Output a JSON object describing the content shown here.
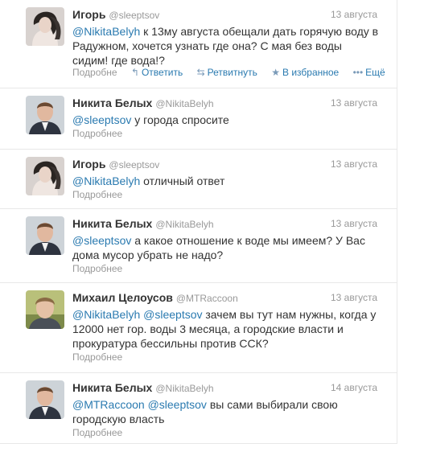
{
  "tweets": [
    {
      "name": "Игорь",
      "handle": "@sleeptsov",
      "date": "13 августа",
      "mentions": [
        "@NikitaBelyh"
      ],
      "text": " к 13му августа обещали дать горячую воду в Радужном, хочется узнать где она? С мая без воды сидим! где вода!?",
      "more": "Подробне",
      "actions": {
        "reply": "Ответить",
        "retweet": "Ретвитнуть",
        "favorite": "В избранное",
        "ellipsis": "Ещё"
      }
    },
    {
      "name": "Никита Белых",
      "handle": "@NikitaBelyh",
      "date": "13 августа",
      "mentions": [
        "@sleeptsov"
      ],
      "text": " у города спросите",
      "more": "Подробнее"
    },
    {
      "name": "Игорь",
      "handle": "@sleeptsov",
      "date": "13 августа",
      "mentions": [
        "@NikitaBelyh"
      ],
      "text": " отличный ответ",
      "more": "Подробнее"
    },
    {
      "name": "Никита Белых",
      "handle": "@NikitaBelyh",
      "date": "13 августа",
      "mentions": [
        "@sleeptsov"
      ],
      "text": " а какое отношение к воде мы имеем? У Вас дома мусор убрать не надо?",
      "more": "Подробнее"
    },
    {
      "name": "Михаил Целоусов",
      "handle": "@MTRaccoon",
      "date": "13 августа",
      "mentions": [
        "@NikitaBelyh",
        "@sleeptsov"
      ],
      "text": " зачем вы тут нам нужны, когда у 12000 нет гор. воды 3 месяца, а городские власти и прокуратура бессильны против ССК?",
      "more": "Подробнее"
    },
    {
      "name": "Никита Белых",
      "handle": "@NikitaBelyh",
      "date": "14 августа",
      "mentions": [
        "@MTRaccoon",
        "@sleeptsov"
      ],
      "text": " вы сами выбирали свою городскую власть",
      "more": "Подробнее"
    }
  ]
}
